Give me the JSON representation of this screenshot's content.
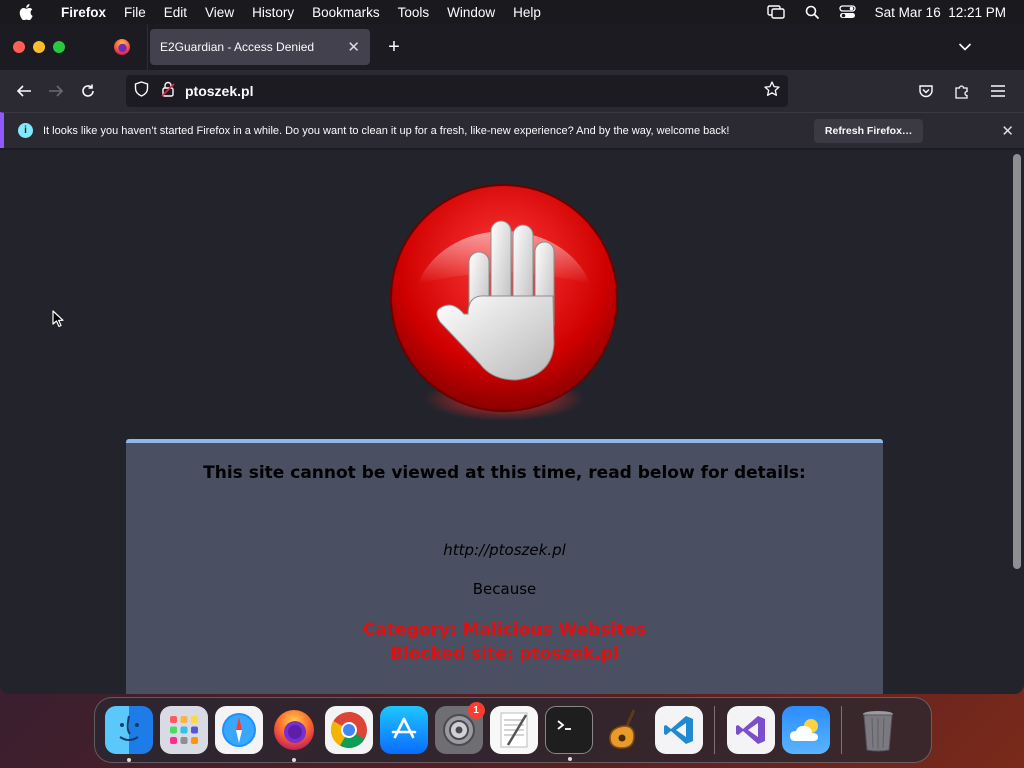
{
  "menubar": {
    "app_name": "Firefox",
    "menus": [
      "File",
      "Edit",
      "View",
      "History",
      "Bookmarks",
      "Tools",
      "Window",
      "Help"
    ],
    "datetime": "Sat Mar 16  12:21 PM"
  },
  "browser": {
    "tab_title": "E2Guardian - Access Denied",
    "url": "ptoszek.pl"
  },
  "notification": {
    "message": "It looks like you haven’t started Firefox in a while. Do you want to clean it up for a fresh, like-new experience? And by the way, welcome back!",
    "button_label": "Refresh Firefox…"
  },
  "page": {
    "heading": "This site cannot be viewed at this time, read below for details:",
    "blocked_url": "http://ptoszek.pl",
    "because": "Because",
    "category": "Category: Malicious Websites",
    "blocked_site": "Blocked site: ptoszek.pl"
  },
  "dock": {
    "apps": [
      "finder",
      "launchpad",
      "safari",
      "firefox",
      "chrome",
      "app-store",
      "system-settings",
      "textedit",
      "terminal",
      "garageband",
      "vscode",
      "visual-studio",
      "weather",
      "trash"
    ],
    "settings_badge": "1"
  },
  "colors": {
    "panel_bg": "#4a4f62",
    "panel_accent": "#8fb8e8",
    "reason_red": "#dd1111",
    "page_bg": "#23242b"
  }
}
